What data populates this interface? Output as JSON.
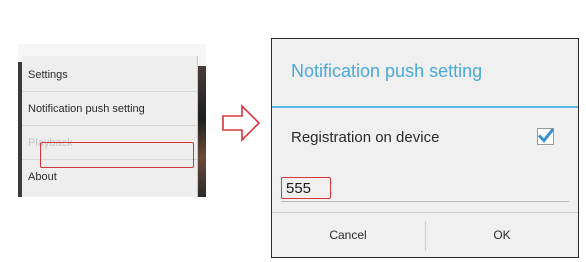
{
  "menu": {
    "items": [
      {
        "label": "Settings",
        "enabled": true
      },
      {
        "label": "Notification push setting",
        "enabled": true,
        "highlighted": true
      },
      {
        "label": "Playback",
        "enabled": false
      },
      {
        "label": "About",
        "enabled": true
      }
    ]
  },
  "arrow": {
    "icon": "right-arrow-icon"
  },
  "dialog": {
    "title": "Notification push setting",
    "registration_label": "Registration on device",
    "registration_checked": true,
    "value": "555",
    "cancel_label": "Cancel",
    "ok_label": "OK"
  },
  "colors": {
    "accent": "#4aa8d8",
    "highlight_box": "#d9343a",
    "checkbox_fill": "#3b8fd0"
  }
}
